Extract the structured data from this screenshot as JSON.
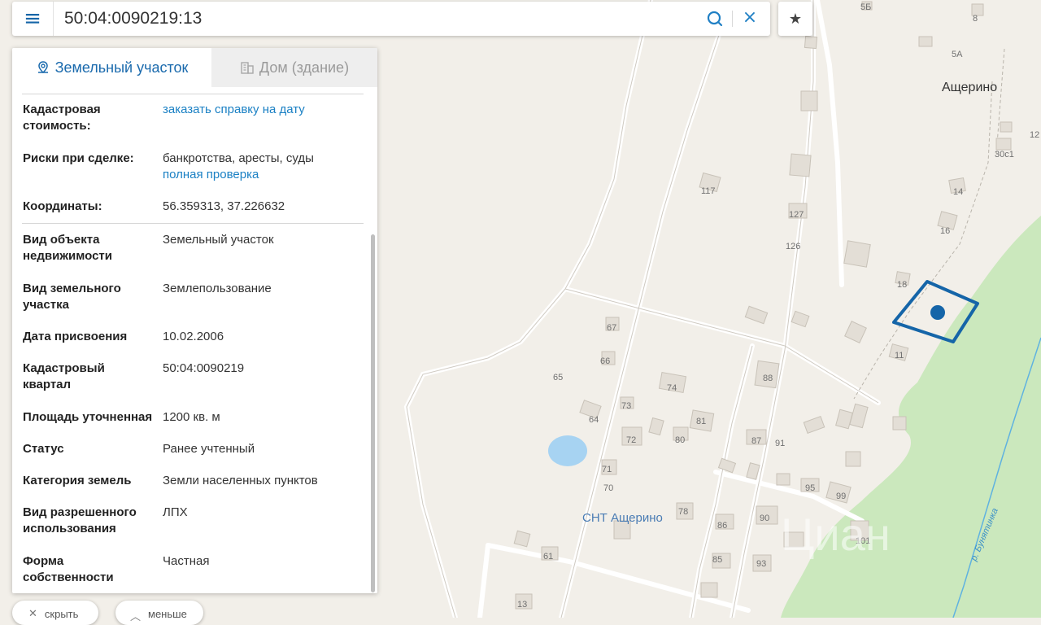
{
  "search": {
    "value": "50:04:0090219:13",
    "menu_icon": "hamburger-menu-icon",
    "search_icon": "search-icon",
    "clear_icon": "close-icon",
    "clear_glyph": "×",
    "star_icon": "star-icon",
    "star_glyph": "★"
  },
  "tabs": [
    {
      "label": "Земельный участок",
      "icon": "map-pin-icon",
      "active": true
    },
    {
      "label": "Дом (здание)",
      "icon": "building-icon",
      "active": false
    }
  ],
  "details": {
    "cadastral_value": {
      "label": "Кадастровая стоимость:",
      "link": "заказать справку на дату"
    },
    "risks": {
      "label": "Риски при сделке:",
      "value": "банкротства, аресты, суды",
      "link": "полная проверка"
    },
    "coordinates": {
      "label": "Координаты:",
      "value": "56.359313, 37.226632"
    },
    "object_type": {
      "label": "Вид объекта недвижимости",
      "value": "Земельный участок"
    },
    "plot_type": {
      "label": "Вид земельного участка",
      "value": "Землепользование"
    },
    "assigned_date": {
      "label": "Дата присвоения",
      "value": "10.02.2006"
    },
    "quarter": {
      "label": "Кадастровый квартал",
      "value": "50:04:0090219"
    },
    "area": {
      "label": "Площадь уточненная",
      "value": "1200 кв. м"
    },
    "status": {
      "label": "Статус",
      "value": "Ранее учтенный"
    },
    "category": {
      "label": "Категория земель",
      "value": "Земли населенных пунктов"
    },
    "permitted_use": {
      "label": "Вид разрешенного использования",
      "value": "ЛПХ"
    },
    "ownership": {
      "label": "Форма собственности",
      "value": "Частная"
    }
  },
  "buttons": {
    "hide": {
      "label": "скрыть",
      "icon": "close-icon",
      "glyph": "✕"
    },
    "less": {
      "label": "меньше",
      "icon": "chevron-up-icon",
      "glyph": "︿"
    }
  },
  "map": {
    "place_labels": {
      "village": "Ащерино",
      "snt": "СНТ Ащерино",
      "river": "р. Бунятинка",
      "watermark": "Циан"
    },
    "house_numbers": [
      "5Б",
      "8",
      "5А",
      "12",
      "30с1",
      "117",
      "127",
      "14",
      "16",
      "126",
      "18",
      "67",
      "66",
      "11",
      "65",
      "74",
      "88",
      "73",
      "64",
      "81",
      "72",
      "80",
      "87",
      "91",
      "71",
      "70",
      "95",
      "99",
      "78",
      "90",
      "86",
      "101",
      "61",
      "85",
      "93",
      "13"
    ],
    "colors": {
      "background": "#f2efe9",
      "forest": "#cbe8bd",
      "pond": "#a7d3f2",
      "plot_outline": "#1565a8",
      "river": "#5fb2e0",
      "accent_link": "#1a80c4"
    }
  }
}
